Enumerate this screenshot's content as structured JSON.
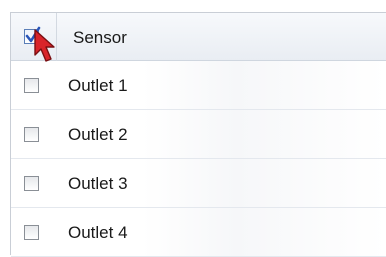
{
  "header": {
    "select_all_checked": true,
    "column_label": "Sensor"
  },
  "rows": [
    {
      "label": "Outlet 1",
      "checked": false
    },
    {
      "label": "Outlet 2",
      "checked": false
    },
    {
      "label": "Outlet 3",
      "checked": false
    },
    {
      "label": "Outlet 4",
      "checked": false
    }
  ],
  "colors": {
    "cursor": "#d9242a",
    "check_accent": "#2a56b8"
  }
}
